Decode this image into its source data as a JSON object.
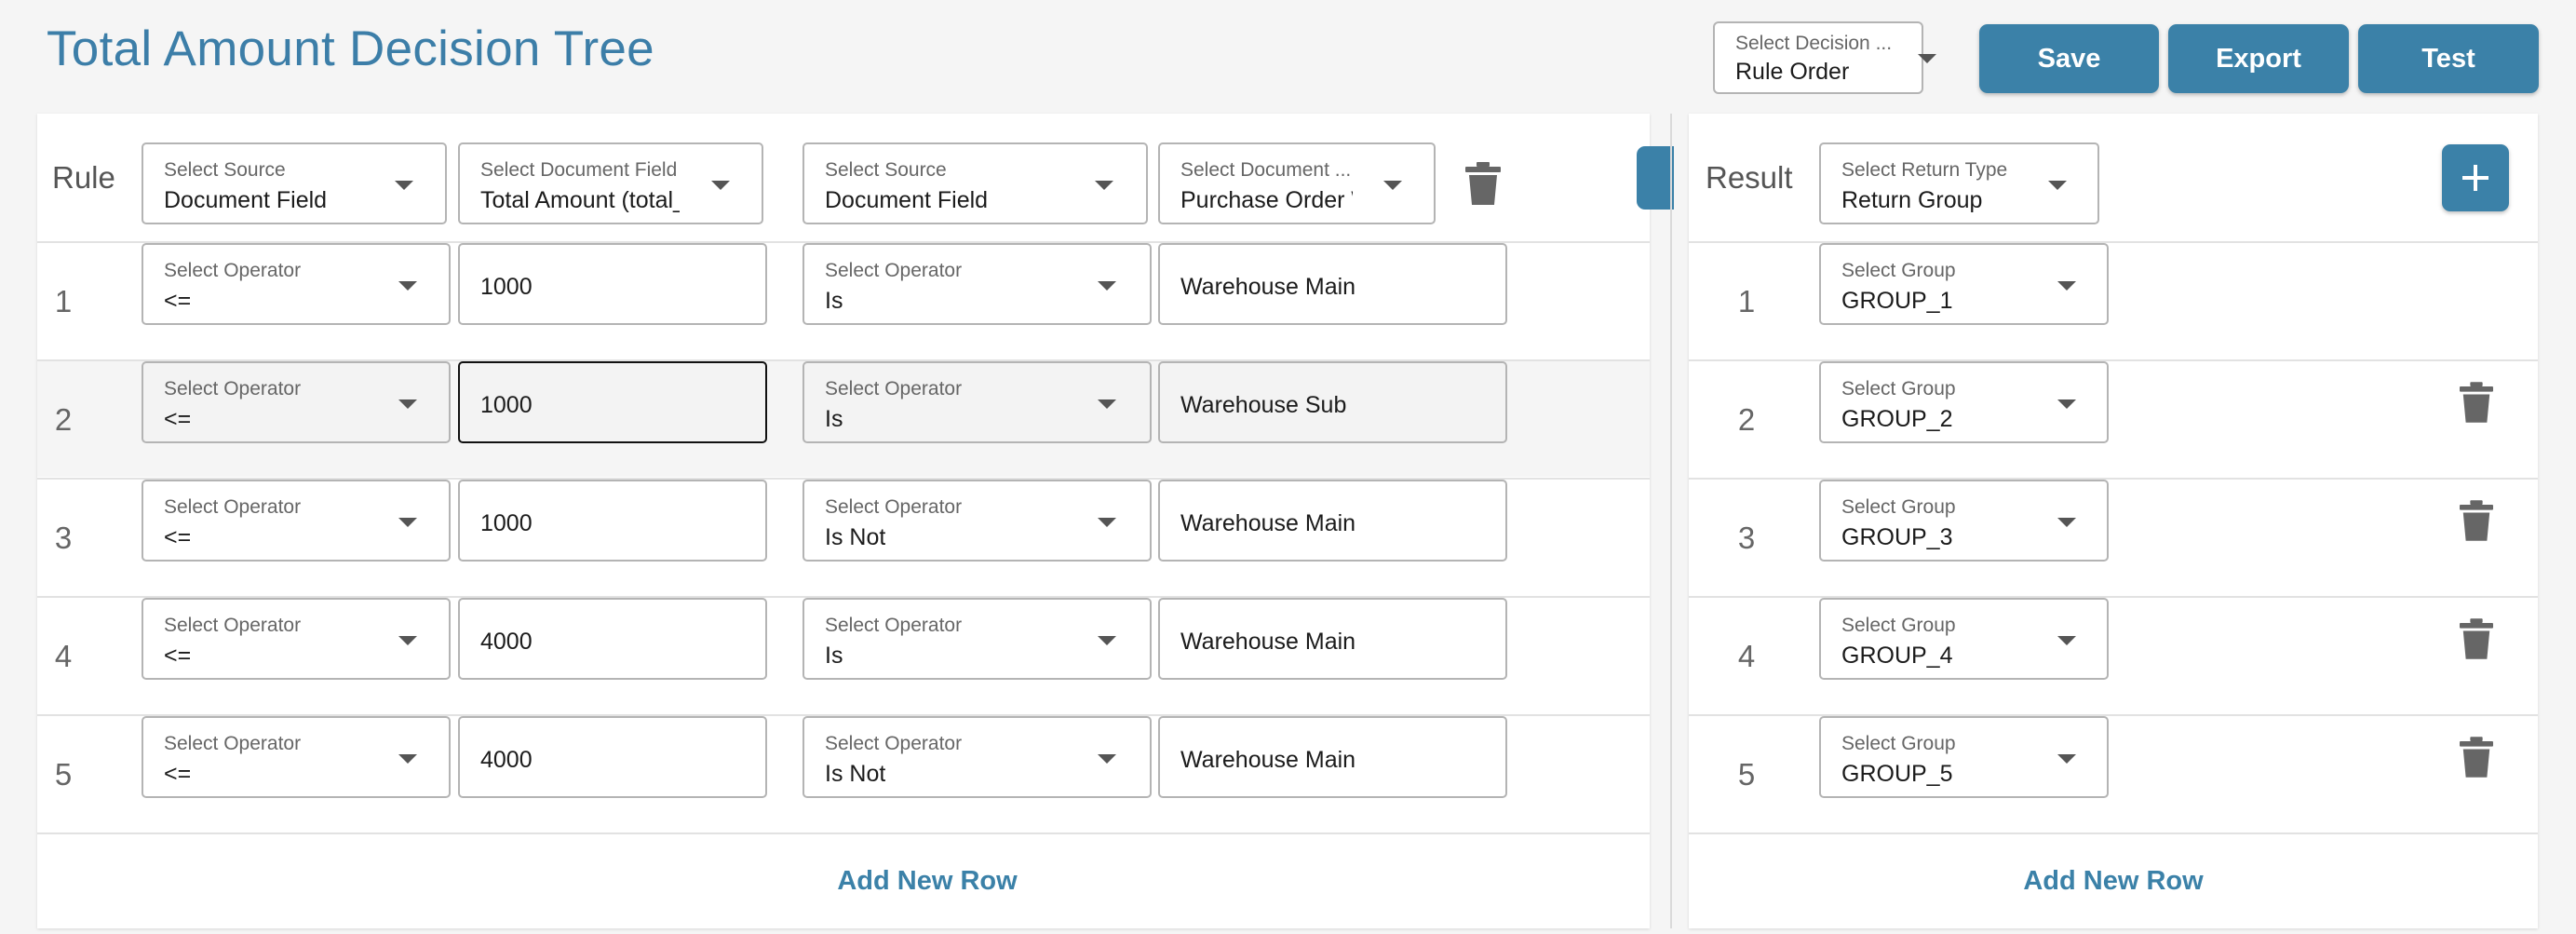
{
  "header": {
    "title": "Total Amount Decision Tree",
    "decision_select": {
      "label": "Select Decision ...",
      "value": "Rule Order"
    },
    "buttons": {
      "save": "Save",
      "export": "Export",
      "test": "Test"
    }
  },
  "colors": {
    "accent": "#3b81a8",
    "title": "#3c7ea8",
    "row_highlight": "#f5f5f5"
  },
  "rules": {
    "header_label": "Rule",
    "columns": [
      {
        "source": {
          "label": "Select Source",
          "value": "Document Field"
        },
        "field": {
          "label": "Select Document Field",
          "value": "Total Amount (total_"
        }
      },
      {
        "source": {
          "label": "Select Source",
          "value": "Document Field"
        },
        "field": {
          "label": "Select Document ...",
          "value": "Purchase Order W"
        }
      }
    ],
    "operator_label": "Select Operator",
    "rows": [
      {
        "num": "1",
        "op1": "<=",
        "val1": "1000",
        "op2": "Is",
        "val2": "Warehouse Main"
      },
      {
        "num": "2",
        "op1": "<=",
        "val1": "1000",
        "op2": "Is",
        "val2": "Warehouse Sub"
      },
      {
        "num": "3",
        "op1": "<=",
        "val1": "1000",
        "op2": "Is Not",
        "val2": "Warehouse Main"
      },
      {
        "num": "4",
        "op1": "<=",
        "val1": "4000",
        "op2": "Is",
        "val2": "Warehouse Main"
      },
      {
        "num": "5",
        "op1": "<=",
        "val1": "4000",
        "op2": "Is Not",
        "val2": "Warehouse Main"
      }
    ],
    "add_row": "Add New Row",
    "icons": {
      "delete_column": "trash-icon",
      "edge_button": "add-icon"
    }
  },
  "result": {
    "header_label": "Result",
    "return_type": {
      "label": "Select Return Type",
      "value": "Return Group"
    },
    "group_label": "Select Group",
    "rows": [
      {
        "num": "1",
        "group": "GROUP_1"
      },
      {
        "num": "2",
        "group": "GROUP_2"
      },
      {
        "num": "3",
        "group": "GROUP_3"
      },
      {
        "num": "4",
        "group": "GROUP_4"
      },
      {
        "num": "5",
        "group": "GROUP_5"
      }
    ],
    "add_row": "Add New Row",
    "icons": {
      "add": "plus-icon",
      "delete_row": "trash-icon"
    }
  }
}
